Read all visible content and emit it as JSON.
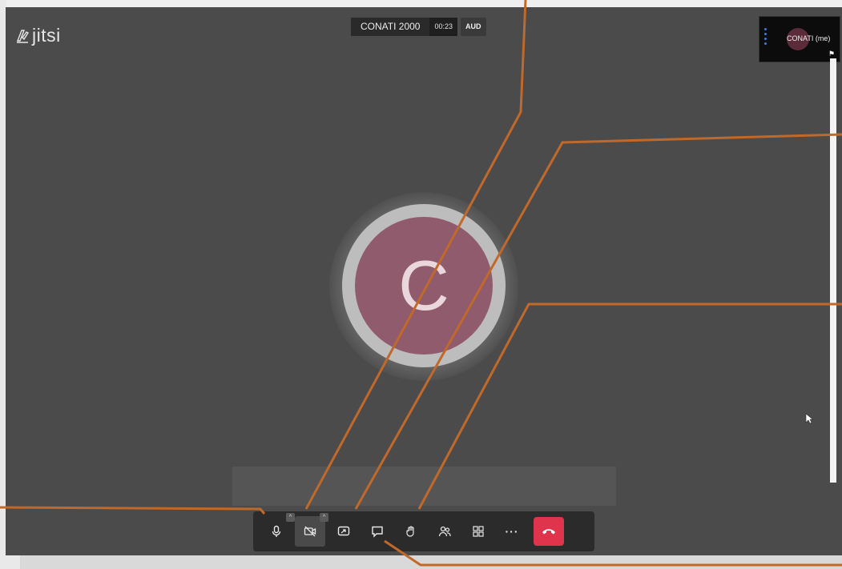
{
  "app": {
    "logo_text": "jitsi"
  },
  "header": {
    "meeting_name": "CONATI 2000",
    "timer": "00:23",
    "badge": "AUD"
  },
  "self_view": {
    "name": "CONATI (me)"
  },
  "participant": {
    "initial": "C",
    "avatar_color": "#8f5b6d"
  },
  "toolbar": {
    "buttons": [
      {
        "id": "mic",
        "icon": "microphone-icon"
      },
      {
        "id": "camera",
        "icon": "camera-off-icon"
      },
      {
        "id": "share",
        "icon": "screen-share-icon"
      },
      {
        "id": "chat",
        "icon": "chat-icon"
      },
      {
        "id": "raise_hand",
        "icon": "raise-hand-icon"
      },
      {
        "id": "participants",
        "icon": "participants-icon"
      },
      {
        "id": "tile_view",
        "icon": "tile-view-icon"
      },
      {
        "id": "more",
        "icon": "more-icon",
        "label": "···"
      },
      {
        "id": "hangup",
        "icon": "hangup-icon"
      }
    ],
    "hangup_color": "#e0344d"
  },
  "annotation_color": "#c0692a"
}
